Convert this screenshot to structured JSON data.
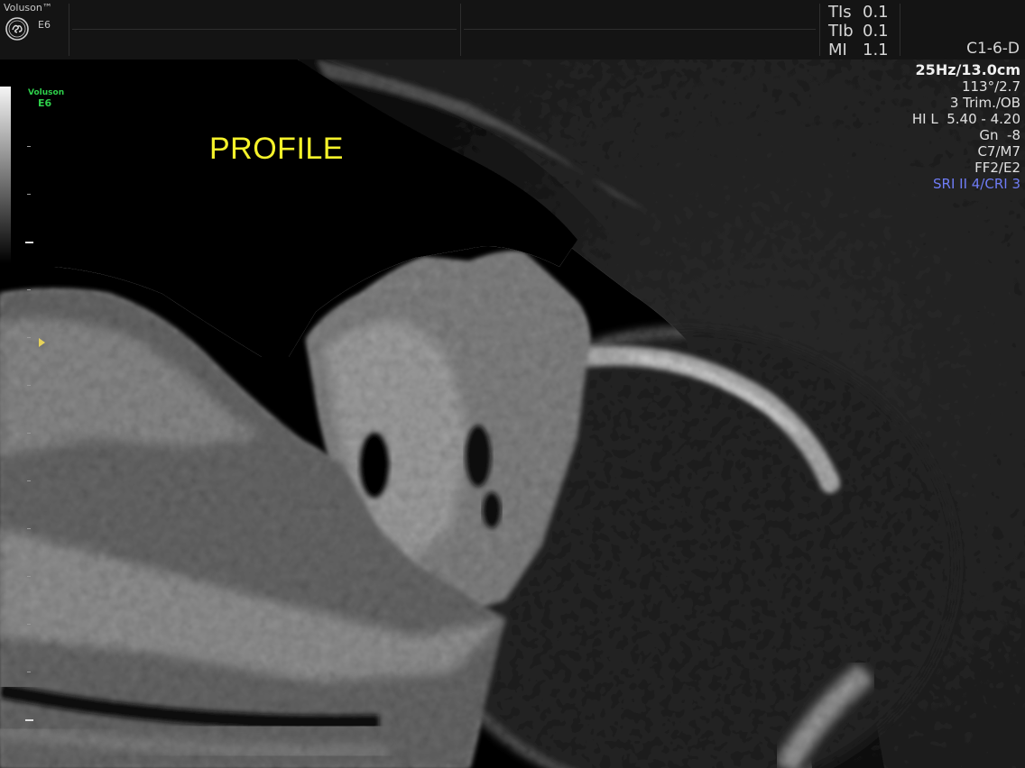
{
  "header": {
    "brand": "Voluson™",
    "model": "E6",
    "safety": [
      {
        "label": "TIs",
        "value": "0.1"
      },
      {
        "label": "TIb",
        "value": "0.1"
      },
      {
        "label": "MI",
        "value": "1.1"
      }
    ],
    "probe": "C1-6-D"
  },
  "image": {
    "mini_brand": "Voluson",
    "mini_model": "E6",
    "annotation": "PROFILE"
  },
  "params": {
    "frame_depth": "25Hz/13.0cm",
    "angle": "113°/2.7",
    "preset": "3 Trim./OB",
    "harmonics": "HI L  5.40 - 4.20",
    "gain": "Gn  -8",
    "map": "C7/M7",
    "filter": "FF2/E2",
    "sri": "SRI II 4/CRI 3"
  },
  "colors": {
    "annotation": "#f5f22a",
    "mini_brand": "#2ed04b",
    "sri": "#6f7cf5",
    "focus_marker": "#e6d25a"
  }
}
